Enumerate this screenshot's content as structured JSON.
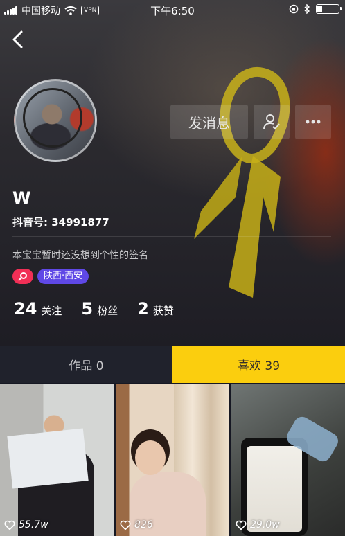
{
  "status_bar": {
    "carrier": "中国移动",
    "vpn": "VPN",
    "time": "下午6:50",
    "battery_level": 0.25
  },
  "icons": {
    "back": "chevron-left-icon",
    "follow": "person-check-icon",
    "more": "more-dots-icon",
    "tag": "search-icon",
    "like": "heart-icon"
  },
  "actions": {
    "message_label": "发消息"
  },
  "profile": {
    "nickname": "W",
    "douyin_id": "抖音号: 34991877",
    "signature": "本宝宝暂时还没想到个性的签名",
    "location": "陕西·西安"
  },
  "stats": [
    {
      "value": "24",
      "label": "关注"
    },
    {
      "value": "5",
      "label": "粉丝"
    },
    {
      "value": "2",
      "label": "获赞"
    }
  ],
  "tabs": {
    "works": "作品 0",
    "likes": "喜欢 39"
  },
  "videos": [
    {
      "likes": "55.7w"
    },
    {
      "likes": "826"
    },
    {
      "likes": "29.0w"
    }
  ],
  "colors": {
    "background": "#161823",
    "active_tab": "#fbce0e",
    "tag_pink": "#f12f56",
    "tag_purple": "#5f48e6"
  }
}
